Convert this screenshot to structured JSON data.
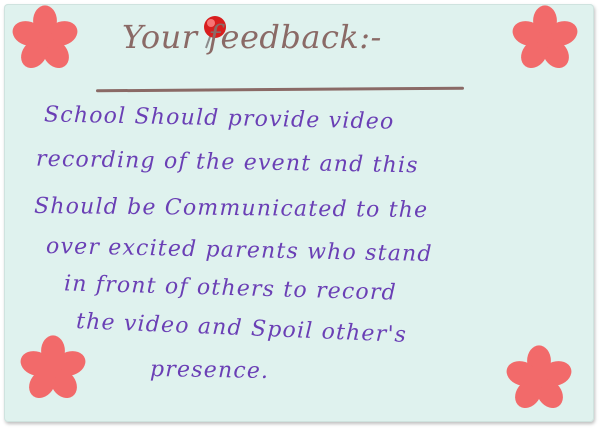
{
  "note": {
    "heading": "Your feedback:-",
    "lines": [
      "School Should provide video",
      "recording of the event and this",
      "Should be Communicated to the",
      "over excited parents who stand",
      "in front of others to record",
      "the video and Spoil other's",
      "presence."
    ]
  },
  "colors": {
    "paper": "#dff2ee",
    "ink": "#6a3fb5",
    "heading_ink": "#8a6a66",
    "flower": "#f26a6a",
    "pin": "#d81e1e"
  },
  "decorations": [
    "flower-icon",
    "push-pin-icon"
  ]
}
